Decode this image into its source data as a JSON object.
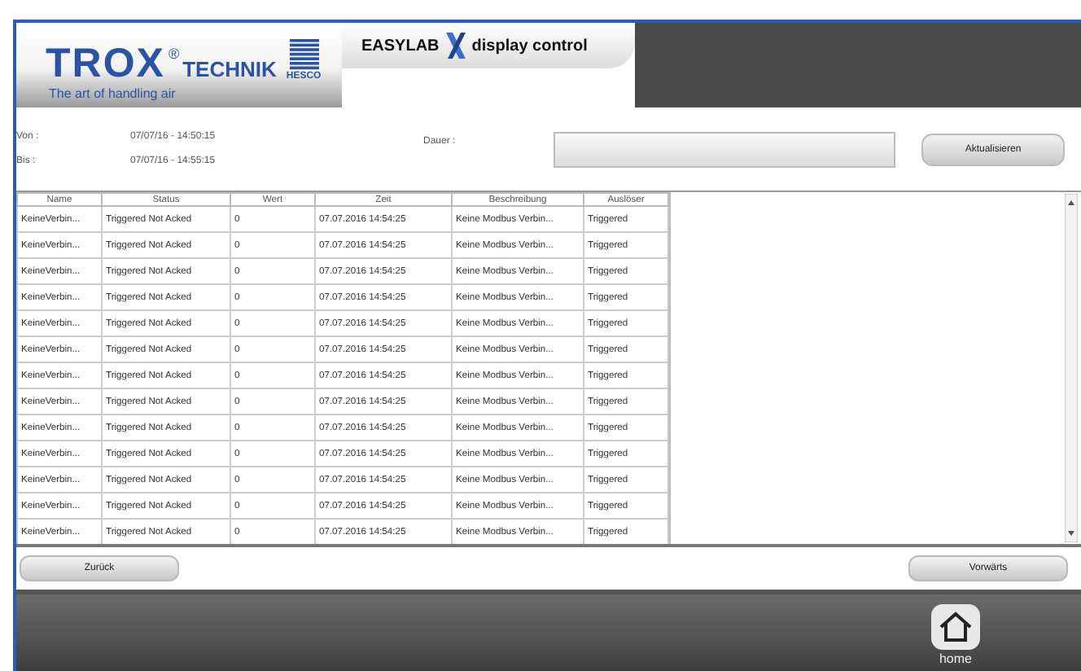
{
  "header": {
    "brand": "TROX",
    "brand_mark": "®",
    "brand_name": "TECHNIK",
    "partner": "HESCO",
    "tagline": "The art of handling air",
    "app_name": "EASYLAB",
    "app_subtitle": "display control"
  },
  "filter": {
    "from_label": "Von :",
    "from_value": "07/07/16 - 14:50:15",
    "to_label": "Bis :",
    "to_value": "07/07/16 - 14:55:15",
    "duration_label": "Dauer :",
    "refresh_button": "Aktualisieren"
  },
  "table": {
    "columns": [
      "Name",
      "Status",
      "Wert",
      "Zeit",
      "Beschreibung",
      "Auslöser"
    ],
    "rows": [
      [
        "KeineVerbin...",
        "Triggered Not Acked",
        "0",
        "07.07.2016 14:54:25",
        "Keine Modbus Verbin...",
        "Triggered"
      ],
      [
        "KeineVerbin...",
        "Triggered Not Acked",
        "0",
        "07.07.2016 14:54:25",
        "Keine Modbus Verbin...",
        "Triggered"
      ],
      [
        "KeineVerbin...",
        "Triggered Not Acked",
        "0",
        "07.07.2016 14:54:25",
        "Keine Modbus Verbin...",
        "Triggered"
      ],
      [
        "KeineVerbin...",
        "Triggered Not Acked",
        "0",
        "07.07.2016 14:54:25",
        "Keine Modbus Verbin...",
        "Triggered"
      ],
      [
        "KeineVerbin...",
        "Triggered Not Acked",
        "0",
        "07.07.2016 14:54:25",
        "Keine Modbus Verbin...",
        "Triggered"
      ],
      [
        "KeineVerbin...",
        "Triggered Not Acked",
        "0",
        "07.07.2016 14:54:25",
        "Keine Modbus Verbin...",
        "Triggered"
      ],
      [
        "KeineVerbin...",
        "Triggered Not Acked",
        "0",
        "07.07.2016 14:54:25",
        "Keine Modbus Verbin...",
        "Triggered"
      ],
      [
        "KeineVerbin...",
        "Triggered Not Acked",
        "0",
        "07.07.2016 14:54:25",
        "Keine Modbus Verbin...",
        "Triggered"
      ],
      [
        "KeineVerbin...",
        "Triggered Not Acked",
        "0",
        "07.07.2016 14:54:25",
        "Keine Modbus Verbin...",
        "Triggered"
      ],
      [
        "KeineVerbin...",
        "Triggered Not Acked",
        "0",
        "07.07.2016 14:54:25",
        "Keine Modbus Verbin...",
        "Triggered"
      ],
      [
        "KeineVerbin...",
        "Triggered Not Acked",
        "0",
        "07.07.2016 14:54:25",
        "Keine Modbus Verbin...",
        "Triggered"
      ],
      [
        "KeineVerbin...",
        "Triggered Not Acked",
        "0",
        "07.07.2016 14:54:25",
        "Keine Modbus Verbin...",
        "Triggered"
      ],
      [
        "KeineVerbin...",
        "Triggered Not Acked",
        "0",
        "07.07.2016 14:54:25",
        "Keine Modbus Verbin...",
        "Triggered"
      ]
    ]
  },
  "nav": {
    "back_button": "Zurück",
    "forward_button": "Vorwärts"
  },
  "footer": {
    "home_label": "home"
  }
}
